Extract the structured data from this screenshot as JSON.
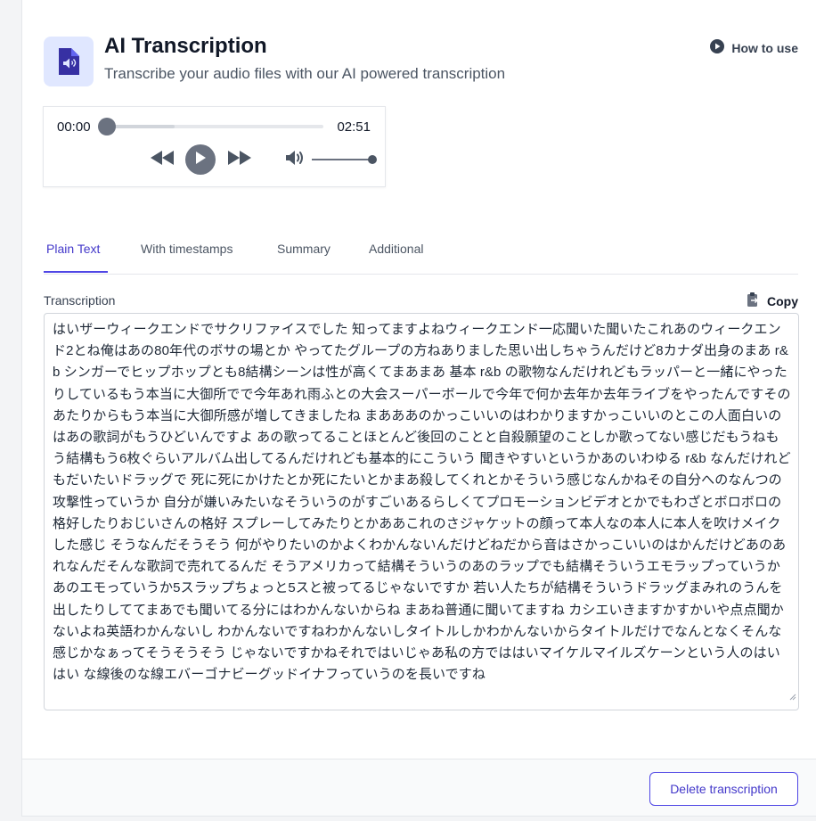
{
  "header": {
    "title": "AI Transcription",
    "subtitle": "Transcribe your audio files with our AI powered transcription",
    "app_icon": "audio-file-icon",
    "how_to_use": "How to use"
  },
  "player": {
    "current_time": "00:00",
    "total_time": "02:51",
    "progress": 0,
    "buffered": 0.31,
    "volume": 1.0
  },
  "tabs": [
    {
      "label": "Plain Text",
      "active": true
    },
    {
      "label": "With timestamps",
      "active": false
    },
    {
      "label": "Summary",
      "active": false
    },
    {
      "label": "Additional",
      "active": false
    }
  ],
  "transcription": {
    "label": "Transcription",
    "copy_label": "Copy",
    "text": "はいザーウィークエンドでサクリファイスでした 知ってますよねウィークエンド一応聞いた聞いたこれあのウィークエンド2とね俺はあの80年代のボサの場とか やってたグループの方ねありました思い出しちゃうんだけど8カナダ出身のまあ r&b シンガーでヒップホップとも8結構シーンは性が高くてまあまあ 基本 r&b の歌物なんだけれどもラッパーと一緒にやったりしているもう本当に大御所でで今年あれ雨ふとの大会スーパーボールで今年で何か去年か去年ライブをやったんですそのあたりからもう本当に大御所感が増してきましたね まあああのかっこいいのはわかりますかっこいいのとこの人面白いのはあの歌詞がもうひどいんですよ あの歌ってることほとんど後回のことと自殺願望のことしか歌ってない感じだもうねもう結構もう6枚ぐらいアルバム出してるんだけれども基本的にこういう 聞きやすいというかあのいわゆる r&b なんだけれどもだいたいドラッグで 死に死にかけたとか死にたいとかまあ殺してくれとかそういう感じなんかねその自分へのなんつの攻撃性っていうか 自分が嫌いみたいなそういうのがすごいあるらしくてプロモーションビデオとかでもわざとボロボロの格好したりおじいさんの格好 スプレーしてみたりとかああこれのさジャケットの顔って本人なの本人に本人を吹けメイクした感じ そうなんだそうそう 何がやりたいのかよくわかんないんだけどねだから音はさかっこいいのはかんだけどあのあれなんだそんな歌詞で売れてるんだ そうアメリカって結構そういうのあのラップでも結構そういうエモラップっていうかあのエモっていうか5スラップちょっと5スと被ってるじゃないですか 若い人たちが結構そういうドラッグまみれのうんを出したりしててまあでも聞いてる分にはわかんないからね まあね普通に聞いてますね カシエいきますかすかいや点点聞かないよね英語わかんないし わかんないですねわかんないしタイトルしかわかんないからタイトルだけでなんとなくそんな感じかなぁってそうそうそう じゃないですかねそれではいじゃあ私の方でははいマイケルマイルズケーンという人のはいはい な線後のな線エバーゴナビーグッドイナフっていうのを長いですね"
  },
  "footer": {
    "delete_label": "Delete transcription"
  },
  "colors": {
    "accent": "#4f46e5",
    "accent_text": "#4338ca",
    "icon_bg": "#e0e7ff"
  }
}
